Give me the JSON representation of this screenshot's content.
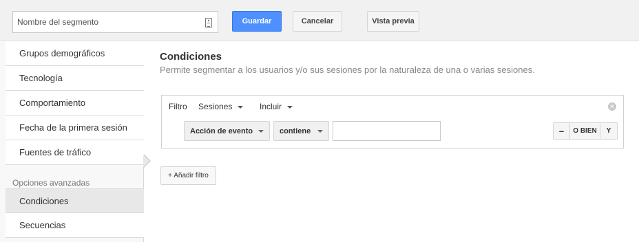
{
  "topbar": {
    "segment_placeholder": "Nombre del segmento",
    "save_label": "Guardar",
    "cancel_label": "Cancelar",
    "preview_label": "Vista previa",
    "save_color": "#4d90fe"
  },
  "sidebar": {
    "items": [
      {
        "label": "Grupos demográficos"
      },
      {
        "label": "Tecnología"
      },
      {
        "label": "Comportamiento"
      },
      {
        "label": "Fecha de la primera sesión"
      },
      {
        "label": "Fuentes de tráfico"
      }
    ],
    "advanced_header": "Opciones avanzadas",
    "advanced_items": [
      {
        "label": "Condiciones",
        "active": true
      },
      {
        "label": "Secuencias"
      }
    ]
  },
  "main": {
    "title": "Condiciones",
    "subtitle": "Permite segmentar a los usuarios y/o sus sesiones por la naturaleza de una o varias sesiones.",
    "filter": {
      "label": "Filtro",
      "scope": "Sesiones",
      "mode": "Incluir",
      "dimension": "Acción de evento",
      "operator": "contiene",
      "value": "",
      "remove_label": "–",
      "or_label": "O BIEN",
      "and_label": "Y",
      "close_icon": "close-circle-icon"
    },
    "add_filter_label": "+ Añadir filtro"
  }
}
